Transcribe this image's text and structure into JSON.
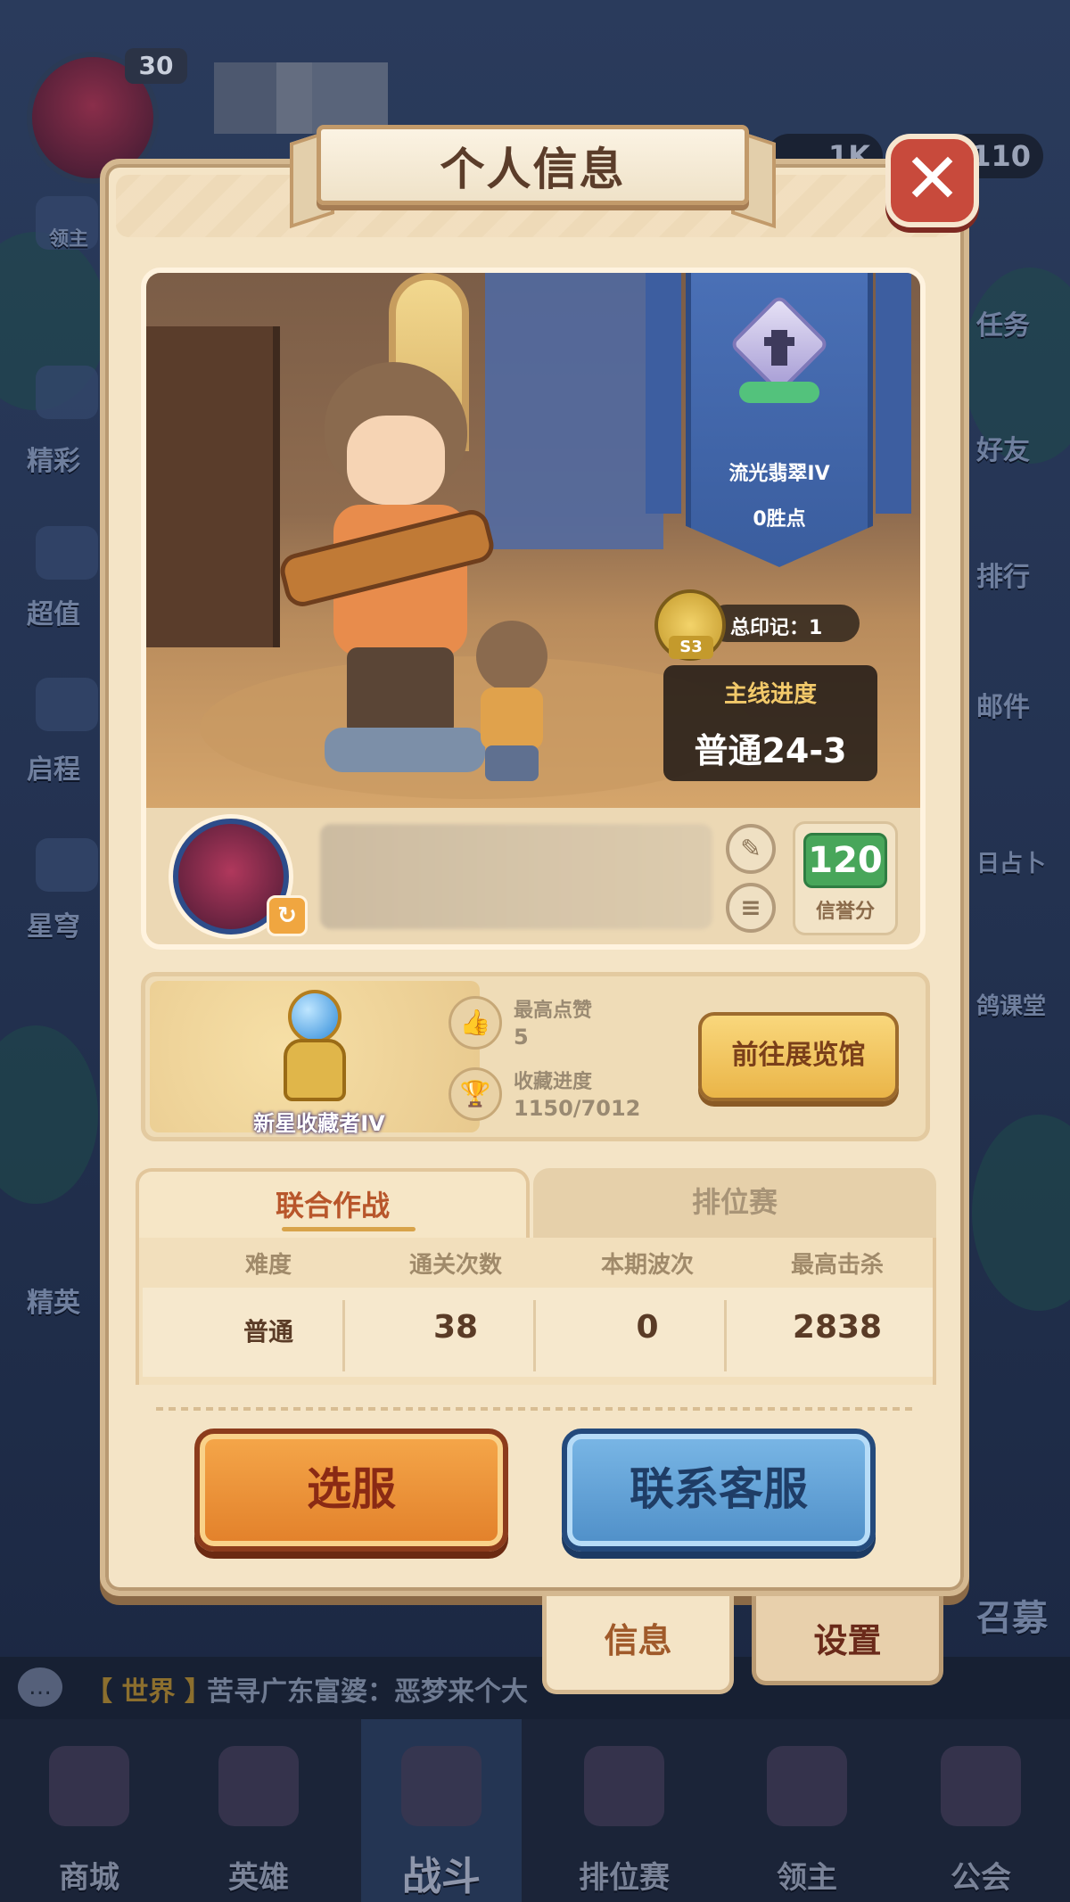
{
  "background": {
    "player_level": "30",
    "resource_values": [
      "1K",
      "110"
    ],
    "side_left_labels": [
      "领主",
      "精彩",
      "超值",
      "启程",
      "星穹",
      "精英"
    ],
    "side_right_labels": [
      "任务",
      "好友",
      "排行",
      "邮件",
      "日占卜",
      "鸽课堂",
      "召募"
    ],
    "chat": {
      "channel": "【 世界 】",
      "message": "苦寻广东富婆：恶梦来个大"
    },
    "bottom_nav": [
      {
        "label": "商城",
        "icon": "shop-icon"
      },
      {
        "label": "英雄",
        "icon": "hero-card-icon"
      },
      {
        "label": "战斗",
        "icon": "battle-swords-icon",
        "active": true
      },
      {
        "label": "排位赛",
        "icon": "ranked-shield-icon"
      },
      {
        "label": "领主",
        "icon": "castle-banner-icon"
      },
      {
        "label": "公会",
        "icon": "guild-icon"
      }
    ]
  },
  "panel": {
    "title": "个人信息",
    "rank": {
      "name": "流光翡翠IV",
      "points": "0胜点"
    },
    "seal": {
      "season": "S3",
      "text": "总印记：1"
    },
    "progress": {
      "label": "主线进度",
      "value": "普通24-3"
    },
    "profile": {
      "avatar_switch_icon": "↻",
      "credit_score": "120",
      "credit_label": "信誉分"
    },
    "collection": {
      "title": "新星收藏者IV",
      "likes_label": "最高点赞",
      "likes_value": "5",
      "progress_label": "收藏进度",
      "progress_value": "1150/7012",
      "gallery_button": "前往展览馆"
    },
    "tabs": {
      "active": "联合作战",
      "inactive": "排位赛"
    },
    "table": {
      "headers": [
        "难度",
        "通关次数",
        "本期波次",
        "最高击杀"
      ],
      "row": [
        "普通",
        "38",
        "0",
        "2838"
      ]
    },
    "buttons": {
      "select_server": "选服",
      "contact_service": "联系客服"
    },
    "side_tabs": {
      "info": "信息",
      "settings": "设置"
    },
    "close_icon": "✕"
  },
  "colors": {
    "panel_bg": "#f4e4c6",
    "accent_orange": "#e2802a",
    "accent_blue": "#4f8fc8",
    "rank_blue": "#3a5d9e",
    "credit_green": "#48a65a"
  }
}
